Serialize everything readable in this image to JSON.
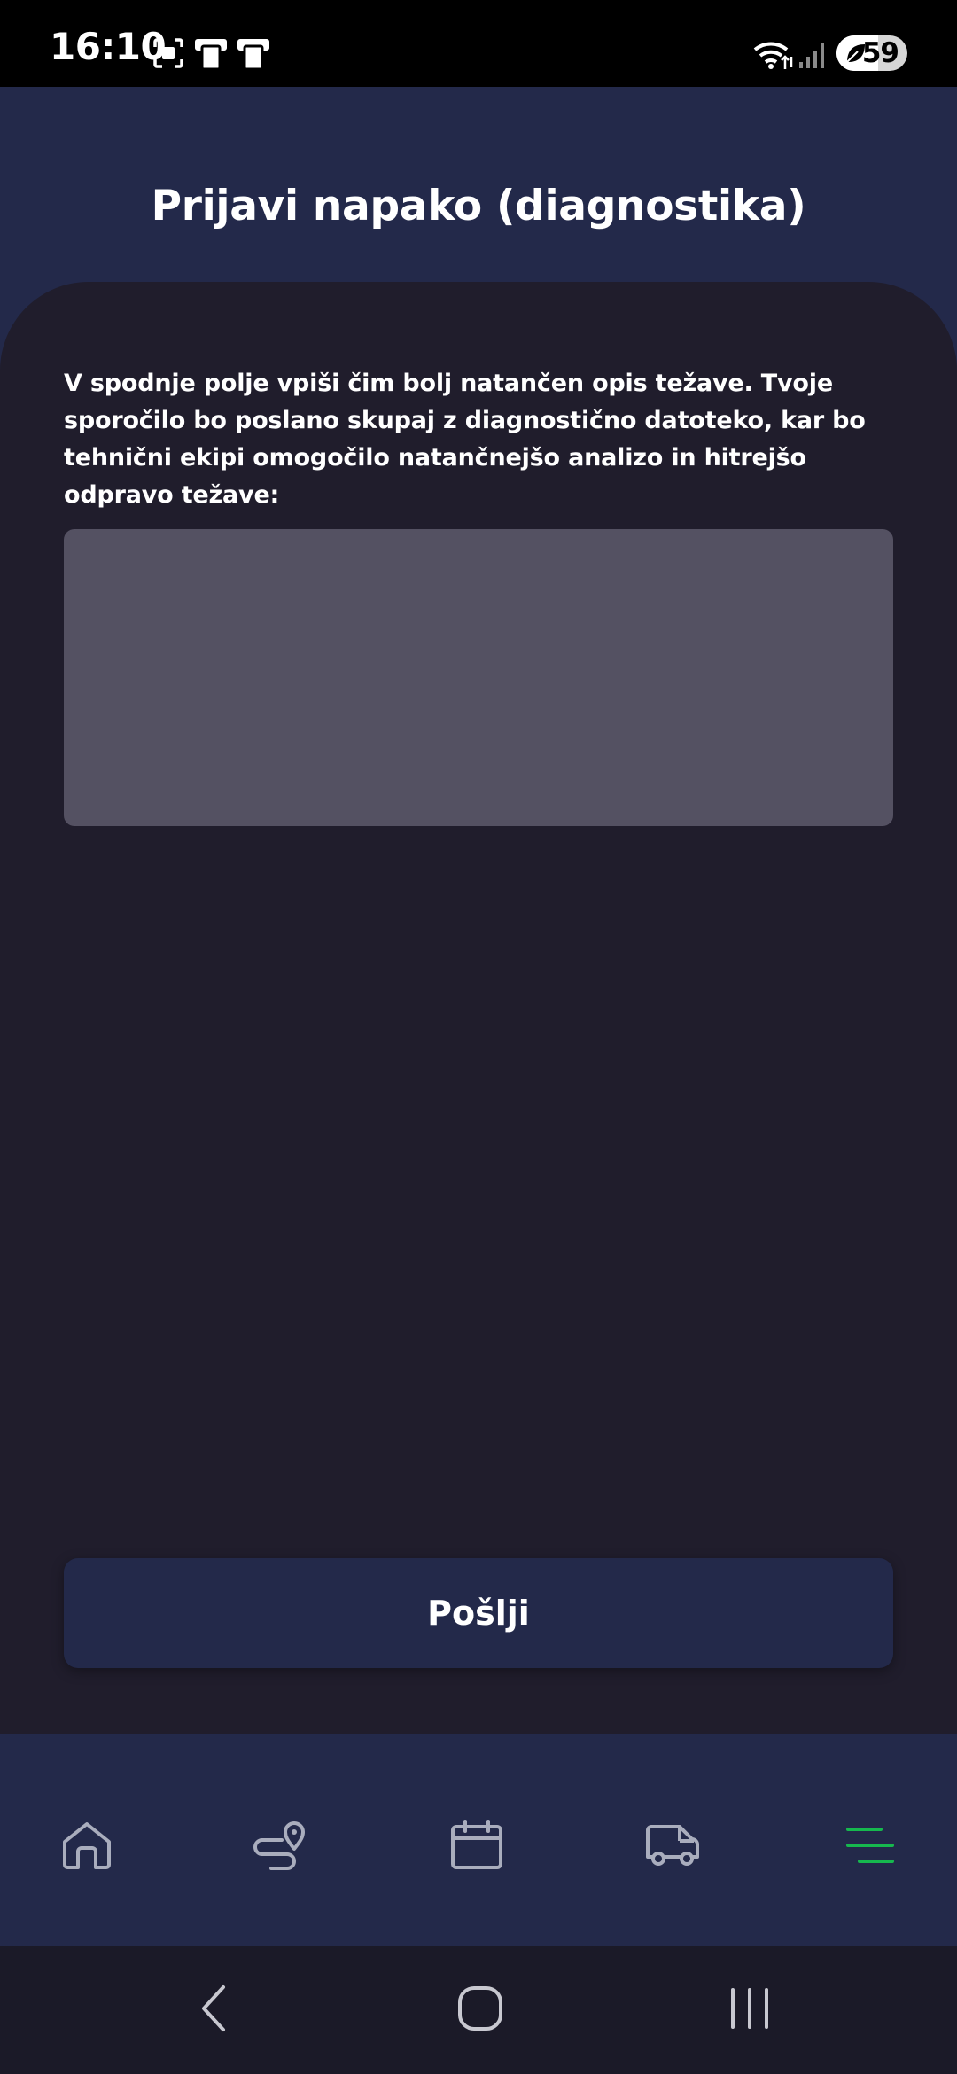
{
  "status_bar": {
    "time": "16:10",
    "notification_icons": [
      "screenshot-icon",
      "device-icon",
      "device-icon"
    ],
    "wifi_icon": "wifi-icon",
    "signal_icon": "signal-icon",
    "battery_level": "59",
    "battery_fraction": 0.59
  },
  "header": {
    "title": "Prijavi napako (diagnostika)"
  },
  "form": {
    "instructions": "V spodnje polje vpiši čim bolj natančen opis težave. Tvoje sporočilo bo poslano skupaj z diagnostično datoteko, kar bo tehnični ekipi omogočilo natančnejšo analizo in hitrejšo odpravo težave:",
    "description_value": "",
    "description_placeholder": "",
    "send_label": "Pošlji"
  },
  "bottom_nav": {
    "items": [
      {
        "icon": "home-icon",
        "active": false
      },
      {
        "icon": "route-icon",
        "active": false
      },
      {
        "icon": "calendar-icon",
        "active": false
      },
      {
        "icon": "van-icon",
        "active": false
      },
      {
        "icon": "menu-icon",
        "active": true
      }
    ],
    "active_color": "#16b84e",
    "inactive_color": "#a9adbd"
  },
  "system_nav": {
    "back_icon": "back-icon",
    "home_icon": "home-button-icon",
    "recents_icon": "recents-icon"
  },
  "colors": {
    "header_bg": "#23294a",
    "content_bg": "#201d2c",
    "input_bg": "#545162",
    "button_bg": "#23294a",
    "system_nav_bg": "#1b1a28"
  }
}
